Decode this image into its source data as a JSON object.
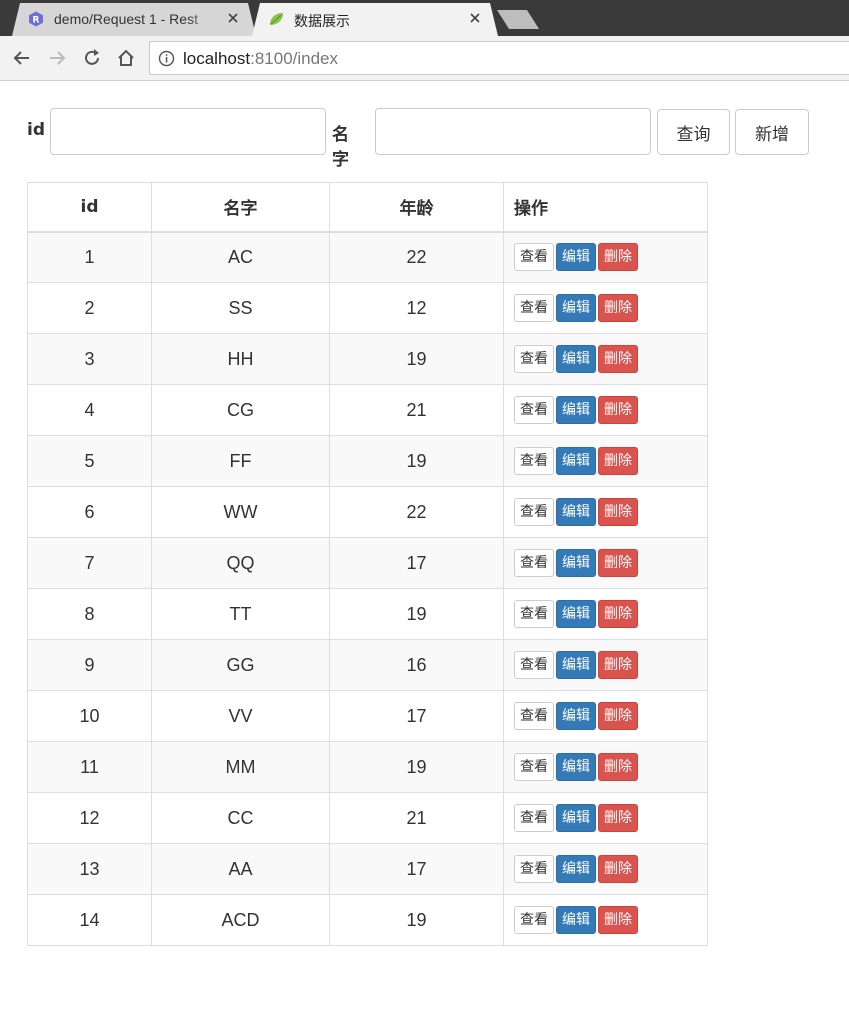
{
  "browser": {
    "tabs": [
      {
        "title": "demo/Request 1 - Rest",
        "active": false,
        "icon": "rest-r-icon"
      },
      {
        "title": "数据展示",
        "active": true,
        "icon": "spring-leaf-icon"
      }
    ],
    "url_host": "localhost",
    "url_rest": ":8100/index"
  },
  "search": {
    "id_label": "id",
    "id_value": "",
    "name_label": "名字",
    "name_value": "",
    "query_button": "查询",
    "add_button": "新增"
  },
  "table": {
    "headers": [
      "id",
      "名字",
      "年龄",
      "操作"
    ],
    "actions": {
      "view": "查看",
      "edit": "编辑",
      "delete": "删除"
    },
    "rows": [
      {
        "id": "1",
        "name": "AC",
        "age": "22"
      },
      {
        "id": "2",
        "name": "SS",
        "age": "12"
      },
      {
        "id": "3",
        "name": "HH",
        "age": "19"
      },
      {
        "id": "4",
        "name": "CG",
        "age": "21"
      },
      {
        "id": "5",
        "name": "FF",
        "age": "19"
      },
      {
        "id": "6",
        "name": "WW",
        "age": "22"
      },
      {
        "id": "7",
        "name": "QQ",
        "age": "17"
      },
      {
        "id": "8",
        "name": "TT",
        "age": "19"
      },
      {
        "id": "9",
        "name": "GG",
        "age": "16"
      },
      {
        "id": "10",
        "name": "VV",
        "age": "17"
      },
      {
        "id": "11",
        "name": "MM",
        "age": "19"
      },
      {
        "id": "12",
        "name": "CC",
        "age": "21"
      },
      {
        "id": "13",
        "name": "AA",
        "age": "17"
      },
      {
        "id": "14",
        "name": "ACD",
        "age": "19"
      }
    ]
  },
  "colors": {
    "primary": "#337ab7",
    "danger": "#d9534f",
    "chrome_dark": "#3a3a3a",
    "chrome_light": "#f2f2f2"
  }
}
